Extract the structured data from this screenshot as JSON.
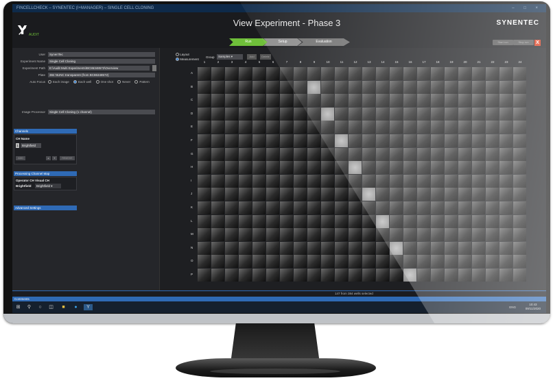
{
  "window": {
    "title": "FINCELLCHECK – SYNENTEC (I+MANAGER) – SINGLE CELL CLONING",
    "controls": "– □ ×"
  },
  "app": {
    "logo": "Y̷",
    "logo_sub": "AUDIT",
    "view_title": "View Experiment - Phase 3",
    "brand": "SYNENTEC",
    "steps": [
      {
        "label": "Run",
        "color": "#6fbf3a"
      },
      {
        "label": "Setup",
        "color": "#8a8a8a"
      },
      {
        "label": "Evaluation",
        "color": "#6e6e6e"
      }
    ],
    "header_buttons": [
      "Start run",
      "Stop run"
    ],
    "close_label": "X"
  },
  "form": {
    "user_label": "User",
    "user_value": "SynenTec",
    "name_label": "Experiment Name",
    "name_value": "Single Cell Cloning",
    "path_label": "Experiment Path",
    "path_value": "E:\\Audit Multi Experiments\\BC86348572\\Overview",
    "plate_label": "Plate",
    "plate_value": "384 NUNC transparent (from BC86348572)",
    "focus_label": "Auto Focus",
    "focus_options": [
      "Each image",
      "Each well",
      "One shot",
      "Never",
      "Pattern"
    ],
    "focus_selected": 1,
    "processor_label": "Image Processor",
    "processor_value": "Single Cell Cloning (1 channel)"
  },
  "channels": {
    "title": "Channels",
    "header": "CH Name",
    "row_index": "1",
    "row_name": "Brightfield",
    "buttons": [
      "ADD",
      "▲",
      "▼",
      "REMOVE"
    ]
  },
  "channel_map": {
    "title": "Processing Channel Map",
    "header": "Operator CH Visual CH",
    "op_ch": "Brightfield",
    "visual_ch": "Brightfield"
  },
  "advanced": {
    "title": "Advanced Settings"
  },
  "plate": {
    "radio_layout": "Layout",
    "radio_measurement": "Measurement",
    "group_label": "Group",
    "group_value": "Samples",
    "group_buttons": [
      "Add",
      "Delete"
    ],
    "columns": [
      "1",
      "2",
      "3",
      "4",
      "5",
      "6",
      "7",
      "8",
      "9",
      "10",
      "11",
      "12",
      "13",
      "14",
      "15",
      "16",
      "17",
      "18",
      "19",
      "20",
      "21",
      "22",
      "23",
      "24"
    ],
    "rows": [
      "A",
      "B",
      "C",
      "D",
      "E",
      "F",
      "G",
      "H",
      "I",
      "J",
      "K",
      "L",
      "M",
      "N",
      "O",
      "P"
    ],
    "status": "147 from 384 wells selected"
  },
  "comments": {
    "title": "Comments"
  },
  "taskbar": {
    "lang": "ENG",
    "time": "10:43",
    "date": "09/11/2020"
  }
}
